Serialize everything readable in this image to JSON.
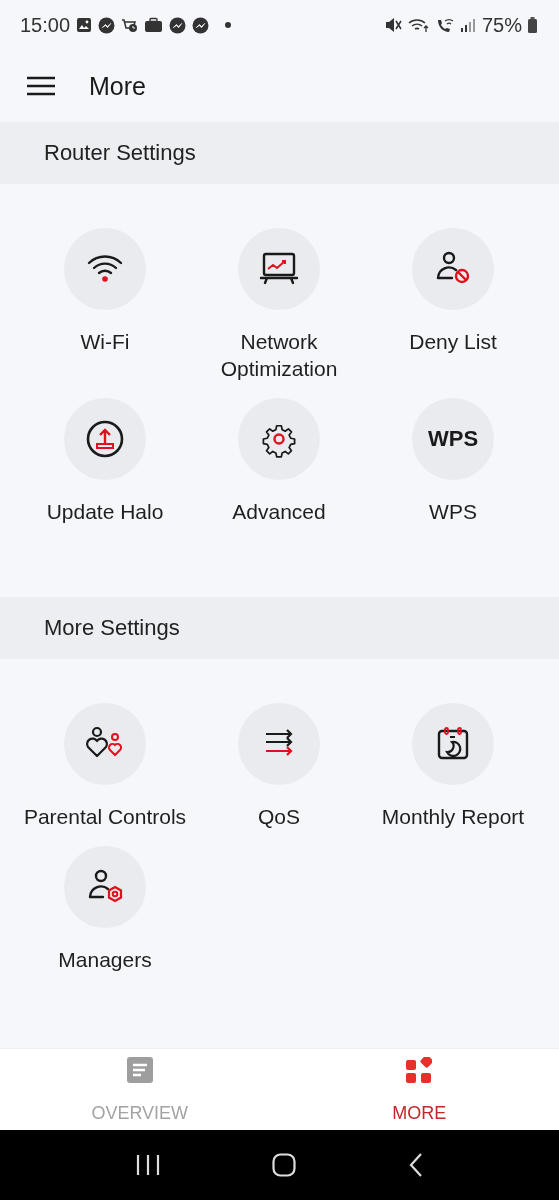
{
  "status_bar": {
    "time": "15:00",
    "battery": "75%"
  },
  "header": {
    "title": "More"
  },
  "sections": [
    {
      "title": "Router Settings",
      "items": [
        {
          "label": "Wi-Fi",
          "kind": "wifi"
        },
        {
          "label": "Network Optimization",
          "kind": "chart"
        },
        {
          "label": "Deny List",
          "kind": "deny"
        },
        {
          "label": "Update Halo",
          "kind": "upload"
        },
        {
          "label": "Advanced",
          "kind": "gear"
        },
        {
          "label": "WPS",
          "kind": "text",
          "icon_text": "WPS"
        }
      ]
    },
    {
      "title": "More Settings",
      "items": [
        {
          "label": "Parental Controls",
          "kind": "parental"
        },
        {
          "label": "QoS",
          "kind": "qos"
        },
        {
          "label": "Monthly Report",
          "kind": "calendar"
        },
        {
          "label": "Managers",
          "kind": "manager"
        }
      ]
    }
  ],
  "bottom_nav": [
    {
      "label": "OVERVIEW",
      "kind": "overview",
      "selected": false
    },
    {
      "label": "MORE",
      "kind": "more",
      "selected": true
    }
  ]
}
